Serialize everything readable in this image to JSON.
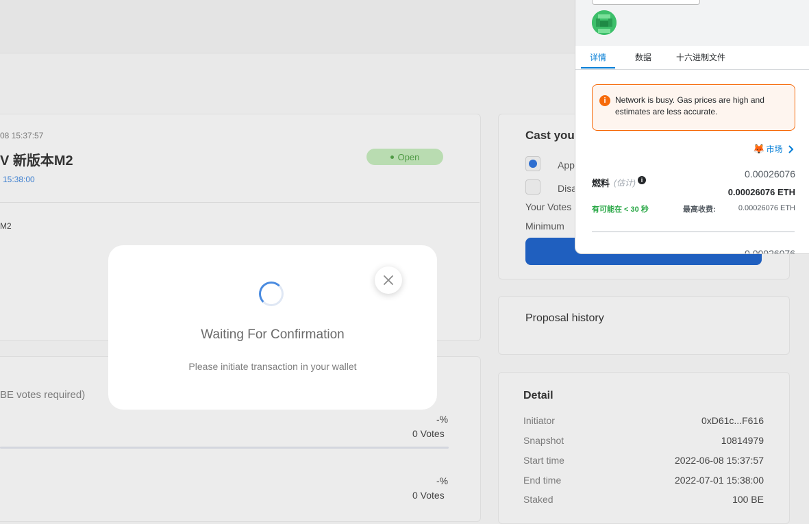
{
  "proposal": {
    "created_time": "08 15:37:57",
    "title": "V 新版本M2",
    "end_time_link": "15:38:00",
    "status": "Open",
    "body_text": "M2"
  },
  "cast_vote": {
    "title": "Cast you",
    "option_approve": "App",
    "option_disapprove": "Disa",
    "your_votes_label": "Your Votes",
    "minimum_label": "Minimum"
  },
  "proposal_history": {
    "title": "Proposal history"
  },
  "results": {
    "requirement_text": "BE votes required)",
    "rows": [
      {
        "percent": "-%",
        "votes": "0 Votes"
      },
      {
        "percent": "-%",
        "votes": "0 Votes"
      }
    ]
  },
  "detail": {
    "title": "Detail",
    "rows": [
      {
        "label": "Initiator",
        "value": "0xD61c...F616"
      },
      {
        "label": "Snapshot",
        "value": "10814979"
      },
      {
        "label": "Start time",
        "value": "2022-06-08 15:37:57"
      },
      {
        "label": "End time",
        "value": "2022-07-01 15:38:00"
      },
      {
        "label": "Staked",
        "value": "100 BE"
      }
    ]
  },
  "modal": {
    "title": "Waiting For Confirmation",
    "subtitle": "Please initiate transaction in your wallet"
  },
  "wallet": {
    "tabs": [
      "详情",
      "数据",
      "十六进制文件"
    ],
    "alert": "Network is busy. Gas prices are high and estimates are less accurate.",
    "market_label": "市场",
    "gas_label": "燃料",
    "gas_estimate_label": "(估计)",
    "gas_value": "0.00026076",
    "gas_value_eth": "0.00026076 ETH",
    "time_hint": "有可能在 < 30 秒",
    "max_fee_label": "最高收费:",
    "max_fee_value": "0.00026076 ETH",
    "next_value": "0.00026076"
  },
  "colors": {
    "accent_blue": "#1f5fbf",
    "open_badge_green": "#4f9a45",
    "warning_orange": "#f66a0a",
    "metamask_blue": "#037dd6",
    "time_green": "#28a745"
  }
}
